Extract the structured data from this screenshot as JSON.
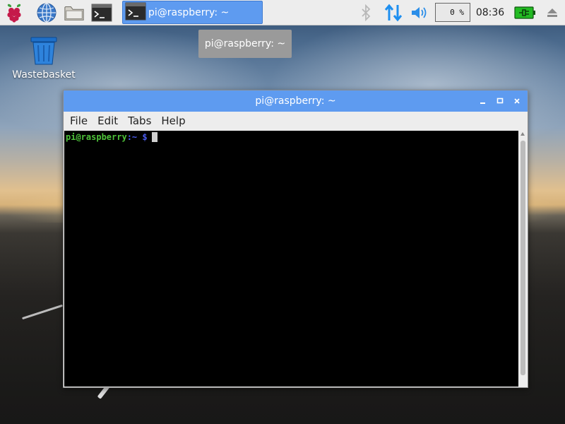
{
  "panel": {
    "launchers": [
      {
        "icon": "raspberry-menu-icon"
      },
      {
        "icon": "web-browser-icon"
      },
      {
        "icon": "file-manager-icon"
      },
      {
        "icon": "terminal-icon"
      }
    ],
    "task": {
      "label": "pi@raspberry: ~",
      "icon": "terminal-icon"
    },
    "tray": {
      "bluetooth_icon": "bluetooth-icon",
      "network_icon": "network-updown-icon",
      "volume_icon": "volume-icon",
      "cpu_usage": "0 %",
      "clock": "08:36",
      "power_icon": "power-plug-icon",
      "eject_icon": "eject-icon"
    },
    "colors": {
      "accent": "#5e9bf0",
      "network": "#1e8ff0",
      "power": "#22bb22"
    }
  },
  "tooltip": {
    "text": "pi@raspberry: ~"
  },
  "desktop": {
    "icons": [
      {
        "label": "Wastebasket",
        "icon": "trash-icon"
      }
    ]
  },
  "window": {
    "title": "pi@raspberry: ~",
    "menu": [
      "File",
      "Edit",
      "Tabs",
      "Help"
    ],
    "terminal": {
      "prompt_user": "pi@raspberry",
      "prompt_path": ":~",
      "prompt_symbol": "$"
    }
  }
}
